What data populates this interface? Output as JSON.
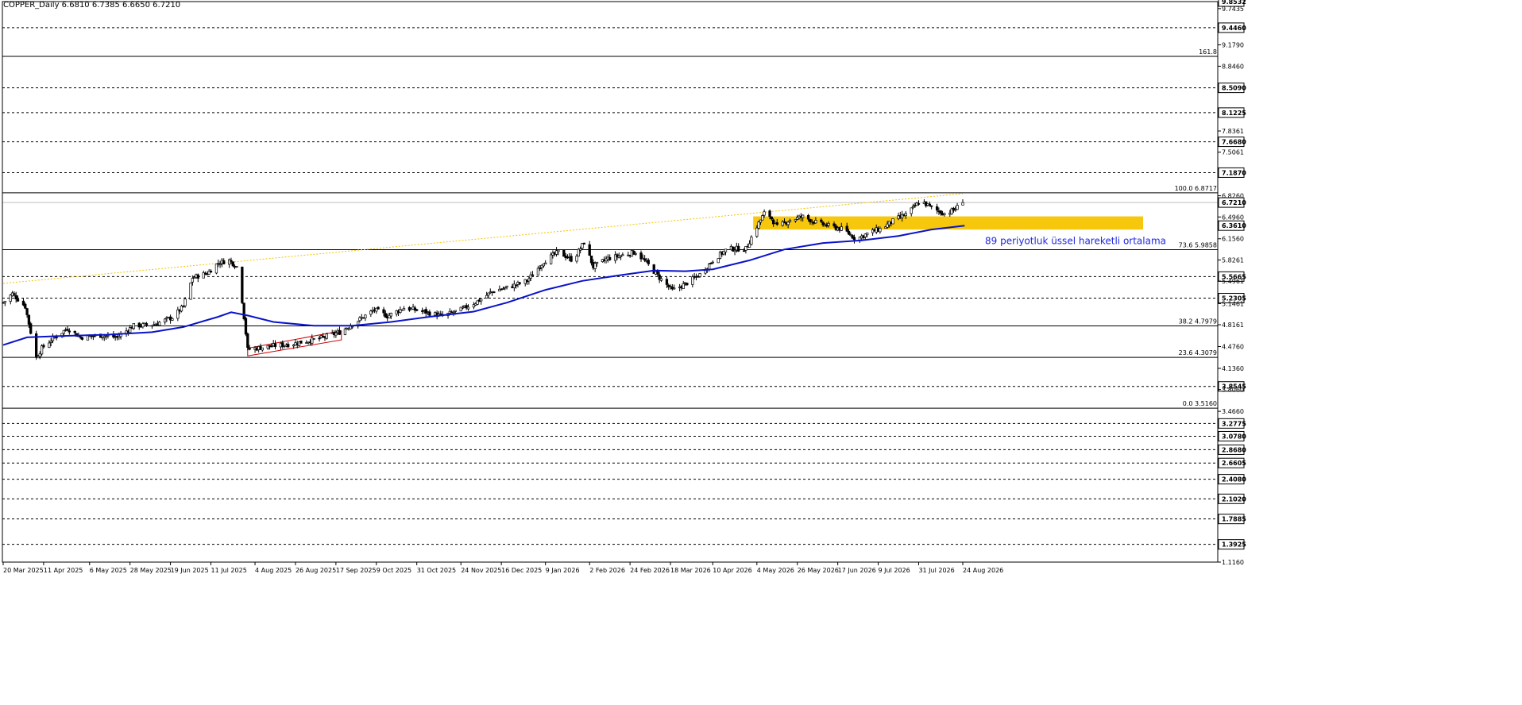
{
  "header": {
    "symbol": "COPPER_Daily",
    "ohlc": "6.6810 6.7385 6.6650 6.7210"
  },
  "annotation": {
    "ema_text": "89 periyotluk üssel hareketli ortalama"
  },
  "colors": {
    "candle": "#000000",
    "ema": "#0a13c8",
    "zone": "#f5c400",
    "trendline": "#f5c400",
    "channel": "#cc0000",
    "ema_label": "#1f28e0"
  },
  "chart_data": {
    "type": "candlestick",
    "symbol": "COPPER",
    "timeframe": "Daily",
    "last_ohlc": {
      "open": 6.681,
      "high": 6.7385,
      "low": 6.665,
      "close": 6.721
    },
    "ylim": [
      1.116,
      9.8532
    ],
    "y_ticks": [
      {
        "value": 9.8532,
        "label": "9.8532",
        "boxed": true
      },
      {
        "value": 9.7435,
        "label": "9.7435",
        "boxed": false
      },
      {
        "value": 9.446,
        "label": "9.4460",
        "boxed": true
      },
      {
        "value": 9.179,
        "label": "9.1790",
        "boxed": false
      },
      {
        "value": 8.846,
        "label": "8.8460",
        "boxed": false
      },
      {
        "value": 8.509,
        "label": "8.5090",
        "boxed": true
      },
      {
        "value": 8.1225,
        "label": "8.1225",
        "boxed": true
      },
      {
        "value": 7.8361,
        "label": "7.8361",
        "boxed": false
      },
      {
        "value": 7.668,
        "label": "7.6680",
        "boxed": true
      },
      {
        "value": 7.5061,
        "label": "7.5061",
        "boxed": false
      },
      {
        "value": 7.187,
        "label": "7.1870",
        "boxed": true
      },
      {
        "value": 6.826,
        "label": "6.8260",
        "boxed": false
      },
      {
        "value": 6.721,
        "label": "6.7210",
        "boxed": true
      },
      {
        "value": 6.496,
        "label": "6.4960",
        "boxed": false
      },
      {
        "value": 6.361,
        "label": "6.3610",
        "boxed": true
      },
      {
        "value": 6.156,
        "label": "6.1560",
        "boxed": false
      },
      {
        "value": 5.8261,
        "label": "5.8261",
        "boxed": false
      },
      {
        "value": 5.5665,
        "label": "5.5665",
        "boxed": true
      },
      {
        "value": 5.4961,
        "label": "5.4961",
        "boxed": false
      },
      {
        "value": 5.2305,
        "label": "5.2305",
        "boxed": true
      },
      {
        "value": 5.1461,
        "label": "5.1461",
        "boxed": false
      },
      {
        "value": 4.8161,
        "label": "4.8161",
        "boxed": false
      },
      {
        "value": 4.476,
        "label": "4.4760",
        "boxed": false
      },
      {
        "value": 4.136,
        "label": "4.1360",
        "boxed": false
      },
      {
        "value": 3.8545,
        "label": "3.8545",
        "boxed": true
      },
      {
        "value": 3.806,
        "label": "3.8060",
        "boxed": false
      },
      {
        "value": 3.466,
        "label": "3.4660",
        "boxed": false
      },
      {
        "value": 3.2775,
        "label": "3.2775",
        "boxed": true
      },
      {
        "value": 3.078,
        "label": "3.0780",
        "boxed": true
      },
      {
        "value": 2.868,
        "label": "2.8680",
        "boxed": true
      },
      {
        "value": 2.6605,
        "label": "2.6605",
        "boxed": true
      },
      {
        "value": 2.408,
        "label": "2.4080",
        "boxed": true
      },
      {
        "value": 2.102,
        "label": "2.1020",
        "boxed": true
      },
      {
        "value": 1.7885,
        "label": "1.7885",
        "boxed": true
      },
      {
        "value": 1.3925,
        "label": "1.3925",
        "boxed": true
      },
      {
        "value": 1.116,
        "label": "1.1160",
        "boxed": false
      }
    ],
    "x_ticks": [
      "20 Mar 2025",
      "11 Apr 2025",
      "6 May 2025",
      "28 May 2025",
      "19 Jun 2025",
      "11 Jul 2025",
      "4 Aug 2025",
      "26 Aug 2025",
      "17 Sep 2025",
      "9 Oct 2025",
      "31 Oct 2025",
      "24 Nov 2025",
      "16 Dec 2025",
      "9 Jan 2026",
      "2 Feb 2026",
      "24 Feb 2026",
      "18 Mar 2026",
      "10 Apr 2026",
      "4 May 2026",
      "26 May 2026",
      "17 Jun 2026",
      "9 Jul 2026",
      "31 Jul 2026",
      "24 Aug 2026"
    ],
    "horizontal_levels": [
      9.446,
      8.509,
      8.1225,
      7.668,
      7.187,
      5.5665,
      5.2305,
      3.8545,
      3.2775,
      3.078,
      2.868,
      2.6605,
      2.408,
      2.102,
      1.7885,
      1.3925
    ],
    "solid_levels": [
      9.0
    ],
    "fibonacci": [
      {
        "label": "161.8",
        "value": 9.0
      },
      {
        "label": "100.0 6.8717",
        "value": 6.8717
      },
      {
        "label": "73.6 5.9858",
        "value": 5.9858
      },
      {
        "label": "38.2 4.7979",
        "value": 4.7979
      },
      {
        "label": "23.6 4.3079",
        "value": 4.3079
      },
      {
        "label": "0.0 3.5160",
        "value": 3.516
      }
    ],
    "support_zone": {
      "from_date": "2 May 2026",
      "to_date": "present",
      "low": 6.3,
      "high": 6.505
    },
    "trendline": {
      "start": {
        "date": "20 Mar 2025",
        "value": 5.46
      },
      "end": {
        "date": "24 Aug 2026",
        "value": 6.86
      }
    },
    "red_channel": {
      "from_date": "31 Jul 2025",
      "to_date": "20 Sep 2025",
      "lower_start": 4.33,
      "lower_end": 4.58,
      "upper_start": 4.45,
      "upper_end": 4.72
    },
    "ema89": [
      [
        "20 Mar 2025",
        4.5
      ],
      [
        "2 Apr 2025",
        4.62
      ],
      [
        "20 Apr 2025",
        4.64
      ],
      [
        "15 May 2025",
        4.66
      ],
      [
        "9 Jun 2025",
        4.7
      ],
      [
        "26 Jun 2025",
        4.78
      ],
      [
        "15 Jul 2025",
        4.94
      ],
      [
        "22 Jul 2025",
        5.01
      ],
      [
        "31 Jul 2025",
        4.96
      ],
      [
        "14 Aug 2025",
        4.86
      ],
      [
        "5 Sep 2025",
        4.8
      ],
      [
        "26 Sep 2025",
        4.8
      ],
      [
        "17 Oct 2025",
        4.86
      ],
      [
        "7 Nov 2025",
        4.94
      ],
      [
        "1 Dec 2025",
        5.02
      ],
      [
        "19 Dec 2025",
        5.16
      ],
      [
        "9 Jan 2026",
        5.36
      ],
      [
        "29 Jan 2026",
        5.5
      ],
      [
        "19 Feb 2026",
        5.59
      ],
      [
        "9 Mar 2026",
        5.66
      ],
      [
        "26 Mar 2026",
        5.65
      ],
      [
        "10 Apr 2026",
        5.68
      ],
      [
        "30 Apr 2026",
        5.82
      ],
      [
        "19 May 2026",
        5.99
      ],
      [
        "9 Jun 2026",
        6.09
      ],
      [
        "30 Jun 2026",
        6.13
      ],
      [
        "20 Jul 2026",
        6.2
      ],
      [
        "7 Aug 2026",
        6.3
      ],
      [
        "25 Aug 2026",
        6.36
      ]
    ],
    "close_path": [
      [
        "20 Mar 2025",
        5.16
      ],
      [
        "25 Mar 2025",
        5.3
      ],
      [
        "1 Apr 2025",
        5.1
      ],
      [
        "7 Apr 2025",
        4.3
      ],
      [
        "10 Apr 2025",
        4.45
      ],
      [
        "16 Apr 2025",
        4.6
      ],
      [
        "24 Apr 2025",
        4.76
      ],
      [
        "1 May 2025",
        4.62
      ],
      [
        "12 May 2025",
        4.65
      ],
      [
        "21 May 2025",
        4.62
      ],
      [
        "30 May 2025",
        4.8
      ],
      [
        "10 Jun 2025",
        4.82
      ],
      [
        "20 Jun 2025",
        4.93
      ],
      [
        "26 Jun 2025",
        5.1
      ],
      [
        "1 Jul 2025",
        5.55
      ],
      [
        "9 Jul 2025",
        5.62
      ],
      [
        "15 Jul 2025",
        5.78
      ],
      [
        "21 Jul 2025",
        5.82
      ],
      [
        "26 Jul 2025",
        5.7
      ],
      [
        "31 Jul 2025",
        4.43
      ],
      [
        "12 Aug 2025",
        4.48
      ],
      [
        "25 Aug 2025",
        4.52
      ],
      [
        "8 Sep 2025",
        4.6
      ],
      [
        "19 Sep 2025",
        4.7
      ],
      [
        "30 Sep 2025",
        4.9
      ],
      [
        "8 Oct 2025",
        5.05
      ],
      [
        "15 Oct 2025",
        4.95
      ],
      [
        "24 Oct 2025",
        5.08
      ],
      [
        "4 Nov 2025",
        5.02
      ],
      [
        "14 Nov 2025",
        4.95
      ],
      [
        "24 Nov 2025",
        5.05
      ],
      [
        "3 Dec 2025",
        5.18
      ],
      [
        "12 Dec 2025",
        5.35
      ],
      [
        "20 Dec 2025",
        5.4
      ],
      [
        "30 Dec 2025",
        5.5
      ],
      [
        "8 Jan 2026",
        5.8
      ],
      [
        "16 Jan 2026",
        5.95
      ],
      [
        "24 Jan 2026",
        5.82
      ],
      [
        "30 Jan 2026",
        6.1
      ],
      [
        "4 Feb 2026",
        5.72
      ],
      [
        "12 Feb 2026",
        5.85
      ],
      [
        "20 Feb 2026",
        5.9
      ],
      [
        "27 Feb 2026",
        5.95
      ],
      [
        "5 Mar 2026",
        5.78
      ],
      [
        "12 Mar 2026",
        5.55
      ],
      [
        "19 Mar 2026",
        5.35
      ],
      [
        "26 Mar 2026",
        5.45
      ],
      [
        "3 Apr 2026",
        5.6
      ],
      [
        "10 Apr 2026",
        5.82
      ],
      [
        "18 Apr 2026",
        6.0
      ],
      [
        "28 Apr 2026",
        6.0
      ],
      [
        "4 May 2026",
        6.35
      ],
      [
        "9 May 2026",
        6.6
      ],
      [
        "15 May 2026",
        6.34
      ],
      [
        "22 May 2026",
        6.45
      ],
      [
        "29 May 2026",
        6.5
      ],
      [
        "6 Jun 2026",
        6.4
      ],
      [
        "13 Jun 2026",
        6.35
      ],
      [
        "20 Jun 2026",
        6.3
      ],
      [
        "27 Jun 2026",
        6.15
      ],
      [
        "4 Jul 2026",
        6.25
      ],
      [
        "11 Jul 2026",
        6.32
      ],
      [
        "18 Jul 2026",
        6.45
      ],
      [
        "25 Jul 2026",
        6.55
      ],
      [
        "1 Aug 2026",
        6.75
      ],
      [
        "8 Aug 2026",
        6.62
      ],
      [
        "14 Aug 2026",
        6.55
      ],
      [
        "19 Aug 2026",
        6.6
      ],
      [
        "24 Aug 2026",
        6.72
      ]
    ]
  }
}
